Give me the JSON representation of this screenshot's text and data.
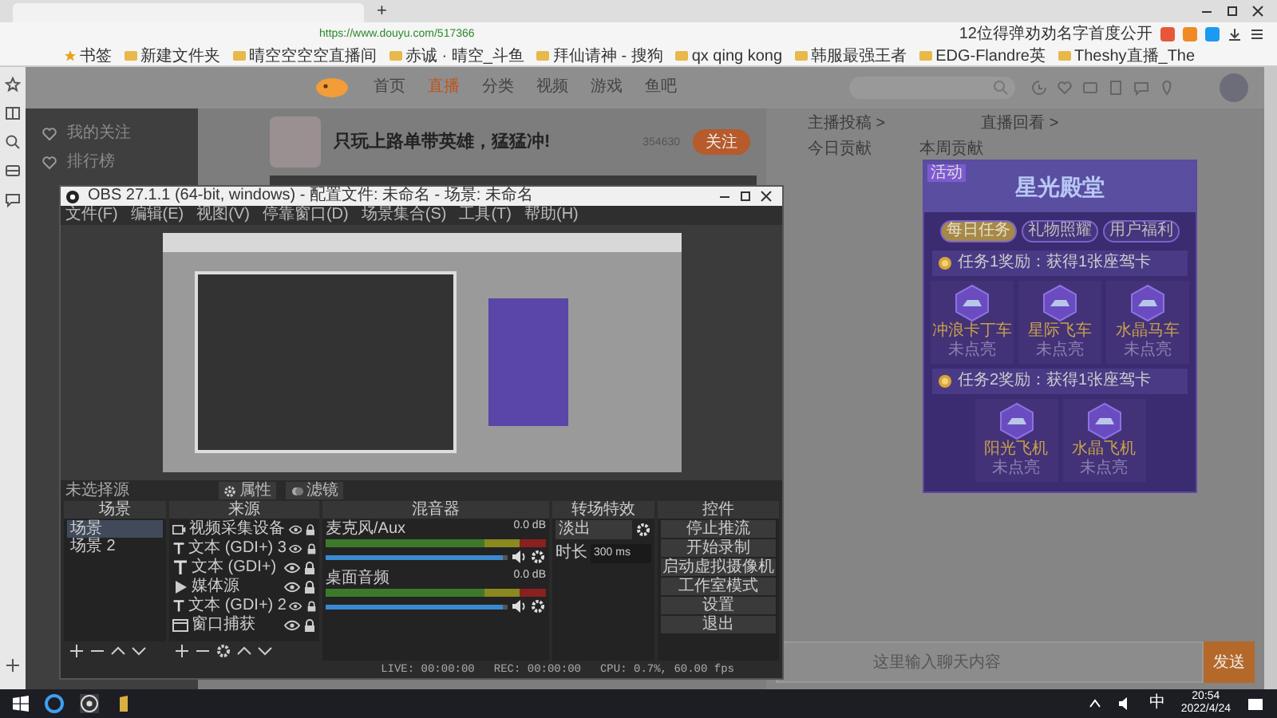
{
  "browser": {
    "new_tab": "+",
    "url": "https://www.douyu.com/517366",
    "search_hint": "12位得弹劝劝名字首度公开",
    "bookmarks": [
      "书签",
      "新建文件夹",
      "晴空空空空直播间",
      "赤诚 · 晴空_斗鱼",
      "拜仙请神 - 搜狗",
      "qx qing kong",
      "韩服最强王者",
      "EDG-Flandre英",
      "Theshy直播_The"
    ]
  },
  "site": {
    "nav": [
      {
        "label": "首页",
        "selected": false
      },
      {
        "label": "直播",
        "selected": true
      },
      {
        "label": "分类",
        "selected": false
      },
      {
        "label": "视频",
        "selected": false
      },
      {
        "label": "游戏",
        "selected": false
      },
      {
        "label": "鱼吧",
        "selected": false
      }
    ],
    "sidebar": [
      "我的关注",
      "排行榜"
    ],
    "room_title": "只玩上路单带英雄，猛猛冲!",
    "followers": "354630",
    "follow_button": "关注",
    "panel_links": [
      "主播投稿 >",
      "直播回看 >"
    ],
    "rank_tabs": [
      "今日贡献",
      "本周贡献"
    ],
    "chat_placeholder": "这里输入聊天内容",
    "send_button": "发送"
  },
  "event_popup": {
    "badge": "活动",
    "title": "星光殿堂",
    "tabs": [
      {
        "label": "每日任务",
        "selected": true
      },
      {
        "label": "礼物照耀",
        "selected": false
      },
      {
        "label": "用户福利",
        "selected": false
      }
    ],
    "tasks": [
      {
        "title": "任务1奖励：获得1张座驾卡",
        "rewards": [
          {
            "name": "冲浪卡丁车",
            "status": "未点亮"
          },
          {
            "name": "星际飞车",
            "status": "未点亮"
          },
          {
            "name": "水晶马车",
            "status": "未点亮"
          }
        ]
      },
      {
        "title": "任务2奖励：获得1张座驾卡",
        "rewards": [
          {
            "name": "阳光飞机",
            "status": "未点亮"
          },
          {
            "name": "水晶飞机",
            "status": "未点亮"
          }
        ]
      }
    ]
  },
  "obs": {
    "title": "OBS 27.1.1 (64-bit, windows) - 配置文件: 未命名 - 场景: 未命名",
    "menu": [
      "文件(F)",
      "编辑(E)",
      "视图(V)",
      "停靠窗口(D)",
      "场景集合(S)",
      "工具(T)",
      "帮助(H)"
    ],
    "no_source": "未选择源",
    "source_buttons": [
      "属性",
      "滤镜"
    ],
    "docks": {
      "scenes": "场景",
      "sources": "来源",
      "mixer": "混音器",
      "transitions": "转场特效",
      "controls": "控件"
    },
    "scenes": [
      {
        "name": "场景",
        "selected": true
      },
      {
        "name": "场景 2",
        "selected": false
      }
    ],
    "sources": [
      {
        "kind": "camera",
        "name": "视频采集设备"
      },
      {
        "kind": "text",
        "name": "文本 (GDI+) 3"
      },
      {
        "kind": "text",
        "name": "文本 (GDI+)"
      },
      {
        "kind": "media",
        "name": "媒体源"
      },
      {
        "kind": "text",
        "name": "文本 (GDI+) 2"
      },
      {
        "kind": "window",
        "name": "窗口捕获"
      }
    ],
    "channels": [
      {
        "name": "麦克风/Aux",
        "reading": "0.0 dB",
        "level": 0.97
      },
      {
        "name": "桌面音频",
        "reading": "0.0 dB",
        "level": 0.97
      }
    ],
    "transition": {
      "value": "淡出",
      "duration_label": "时长",
      "duration": "300 ms"
    },
    "controls": [
      "停止推流",
      "开始录制",
      "启动虚拟摄像机",
      "工作室模式",
      "设置",
      "退出"
    ],
    "status": {
      "live": "LIVE: 00:00:00",
      "rec": "REC: 00:00:00",
      "cpu": "CPU: 0.7%, 60.00 fps"
    }
  },
  "taskbar": {
    "ime": "中",
    "time": "20:54",
    "date": "2022/4/24"
  }
}
